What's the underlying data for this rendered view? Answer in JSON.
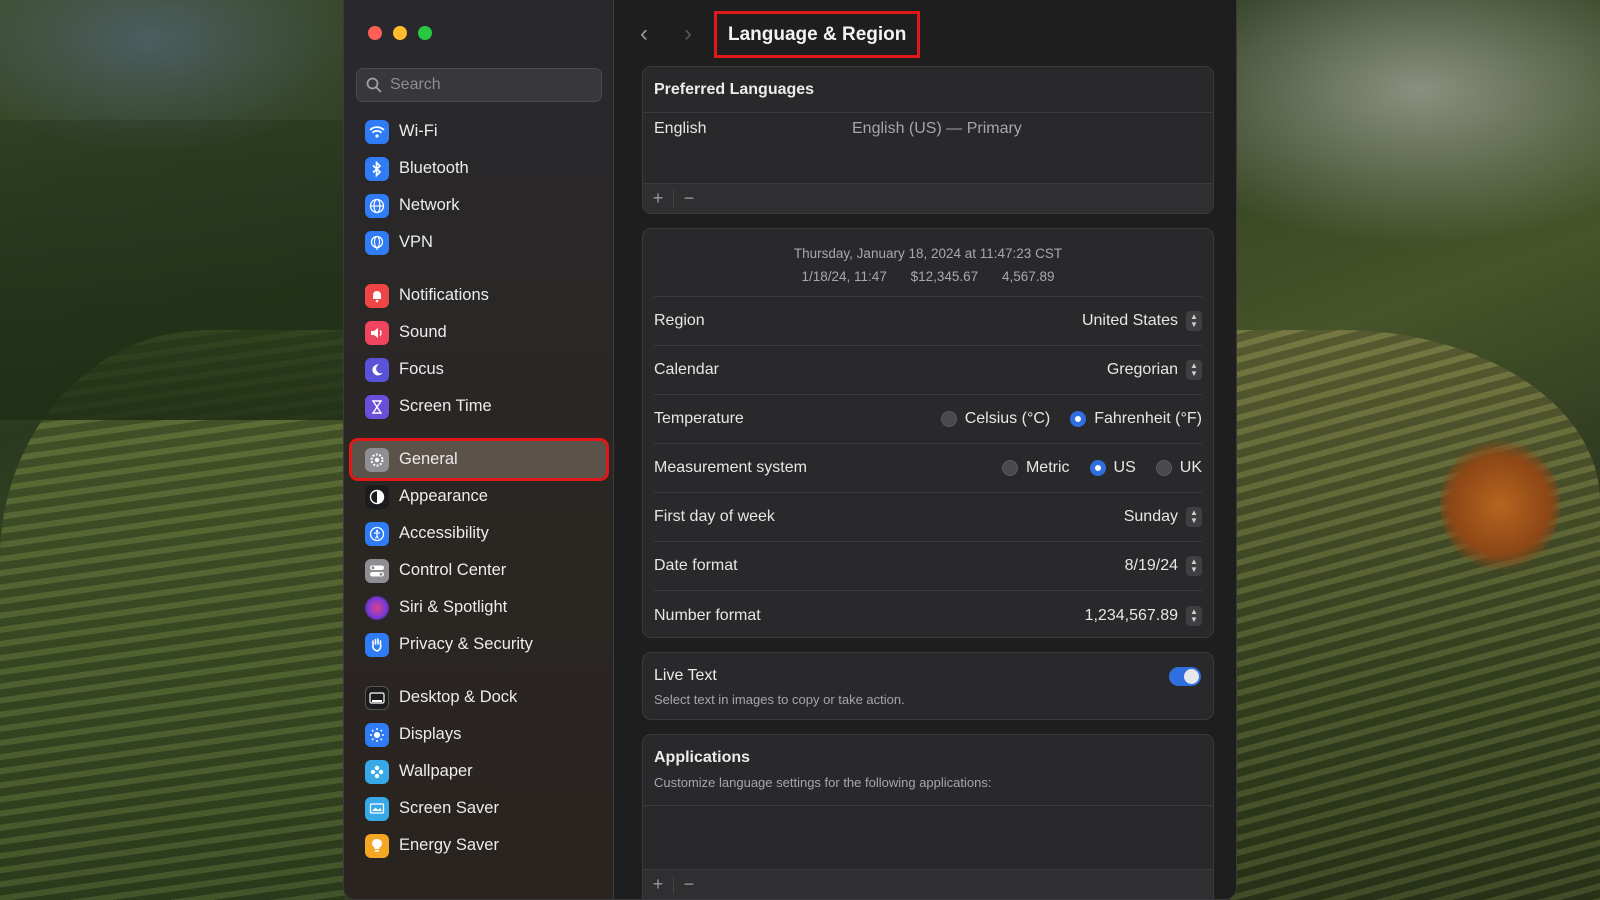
{
  "window": {
    "title": "Language & Region"
  },
  "search": {
    "placeholder": "Search"
  },
  "sidebar": {
    "items": [
      {
        "label": "Wi-Fi",
        "icon": "wifi-icon",
        "color": "#2f7cf6"
      },
      {
        "label": "Bluetooth",
        "icon": "bluetooth-icon",
        "color": "#2f7cf6"
      },
      {
        "label": "Network",
        "icon": "globe-icon",
        "color": "#2f7cf6"
      },
      {
        "label": "VPN",
        "icon": "vpn-globe-icon",
        "color": "#2f7cf6"
      },
      {
        "label": "Notifications",
        "icon": "bell-icon",
        "color": "#f04545"
      },
      {
        "label": "Sound",
        "icon": "speaker-icon",
        "color": "#f0455f"
      },
      {
        "label": "Focus",
        "icon": "moon-icon",
        "color": "#5a52d8"
      },
      {
        "label": "Screen Time",
        "icon": "hourglass-icon",
        "color": "#6a4fd8"
      },
      {
        "label": "General",
        "icon": "gear-icon",
        "color": "#8e8e93",
        "selected": true
      },
      {
        "label": "Appearance",
        "icon": "appearance-icon",
        "color": "#1c1c1e"
      },
      {
        "label": "Accessibility",
        "icon": "accessibility-icon",
        "color": "#2f7cf6"
      },
      {
        "label": "Control Center",
        "icon": "control-center-icon",
        "color": "#8e8e93"
      },
      {
        "label": "Siri & Spotlight",
        "icon": "siri-icon",
        "color": "#7a3ad8"
      },
      {
        "label": "Privacy & Security",
        "icon": "hand-icon",
        "color": "#2f7cf6"
      },
      {
        "label": "Desktop & Dock",
        "icon": "dock-icon",
        "color": "#1c1c1e"
      },
      {
        "label": "Displays",
        "icon": "sun-icon",
        "color": "#2f7cf6"
      },
      {
        "label": "Wallpaper",
        "icon": "wallpaper-icon",
        "color": "#38a9e8"
      },
      {
        "label": "Screen Saver",
        "icon": "screen-saver-icon",
        "color": "#38a9e8"
      },
      {
        "label": "Energy Saver",
        "icon": "bulb-icon",
        "color": "#f5a623"
      }
    ]
  },
  "preferred_languages": {
    "title": "Preferred Languages",
    "language_name": "English",
    "language_detail": "English (US) — Primary",
    "add_label": "+",
    "remove_label": "−"
  },
  "preview": {
    "datetime": "Thursday, January 18, 2024 at 11:47:23 CST",
    "short_date": "1/18/24, 11:47",
    "currency": "$12,345.67",
    "number": "4,567.89"
  },
  "settings": {
    "region_label": "Region",
    "region_value": "United States",
    "calendar_label": "Calendar",
    "calendar_value": "Gregorian",
    "temperature_label": "Temperature",
    "celsius": "Celsius (°C)",
    "fahrenheit": "Fahrenheit (°F)",
    "measurement_label": "Measurement system",
    "metric": "Metric",
    "us": "US",
    "uk": "UK",
    "first_day_label": "First day of week",
    "first_day_value": "Sunday",
    "date_format_label": "Date format",
    "date_format_value": "8/19/24",
    "number_format_label": "Number format",
    "number_format_value": "1,234,567.89"
  },
  "live_text": {
    "title": "Live Text",
    "description": "Select text in images to copy or take action.",
    "enabled": true
  },
  "applications": {
    "title": "Applications",
    "description": "Customize language settings for the following applications:",
    "add_label": "+",
    "remove_label": "−"
  },
  "colors": {
    "accent": "#2f6fe0",
    "highlight_box": "#e01818",
    "selected_row": "#5b5249"
  }
}
